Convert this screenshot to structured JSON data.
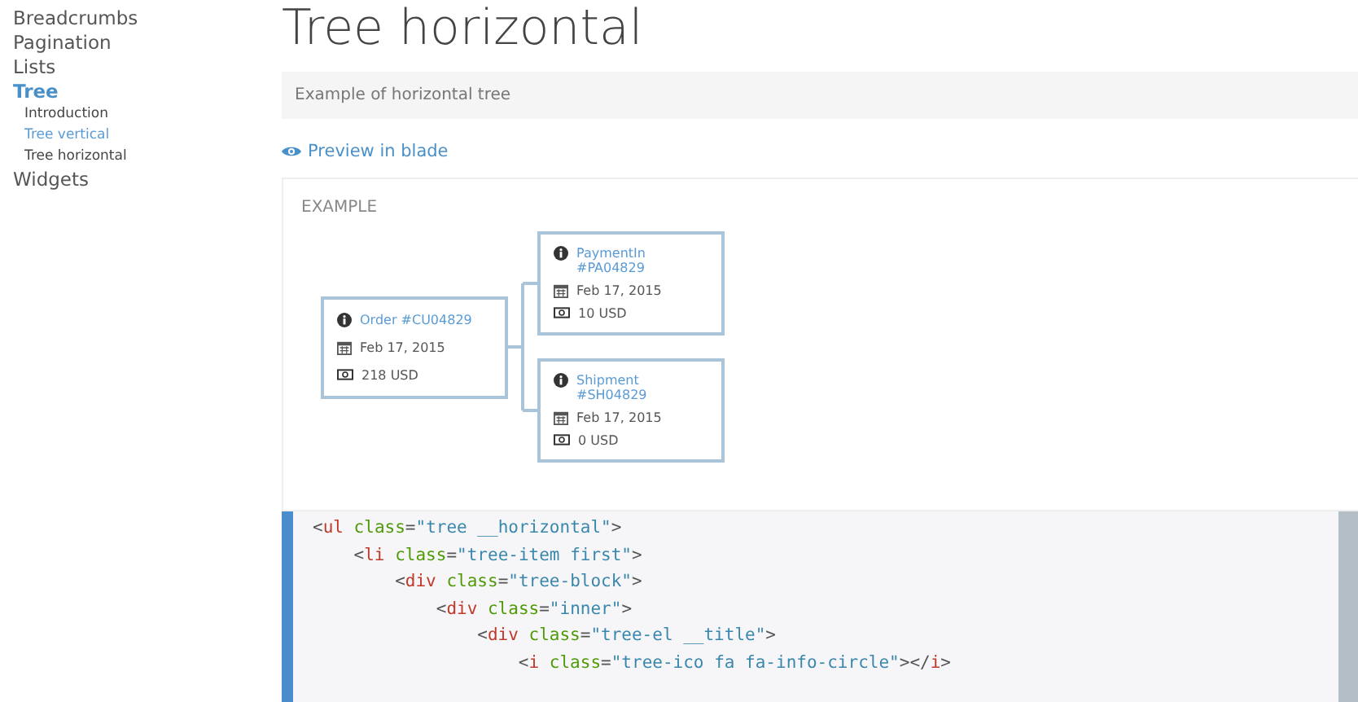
{
  "sidebar": {
    "items": [
      {
        "label": "Breadcrumbs",
        "selected": false
      },
      {
        "label": "Pagination",
        "selected": false
      },
      {
        "label": "Lists",
        "selected": false
      },
      {
        "label": "Tree",
        "selected": true,
        "children": [
          {
            "label": "Introduction",
            "selected": false
          },
          {
            "label": "Tree vertical",
            "selected": true
          },
          {
            "label": "Tree horizontal",
            "selected": false
          }
        ]
      },
      {
        "label": "Widgets",
        "selected": false
      }
    ]
  },
  "page": {
    "title": "Tree horizontal",
    "description": "Example of horizontal tree",
    "preview_link": "Preview in blade"
  },
  "example": {
    "heading": "EXAMPLE",
    "tree": {
      "title": "Order #CU04829",
      "date": "Feb 17, 2015",
      "amount": "218 USD",
      "children": [
        {
          "title": "PaymentIn #PA04829",
          "date": "Feb 17, 2015",
          "amount": "10 USD"
        },
        {
          "title": "Shipment #SH04829",
          "date": "Feb 17, 2015",
          "amount": "0 USD"
        }
      ]
    }
  },
  "code": {
    "lines": [
      [
        {
          "kind": "punct",
          "text": "<"
        },
        {
          "kind": "tag",
          "text": "ul"
        },
        {
          "kind": "attr",
          "text": " class"
        },
        {
          "kind": "punct",
          "text": "="
        },
        {
          "kind": "string",
          "text": "\"tree __horizontal\""
        },
        {
          "kind": "punct",
          "text": ">"
        }
      ],
      [
        {
          "kind": "punct",
          "text": "    <"
        },
        {
          "kind": "tag",
          "text": "li"
        },
        {
          "kind": "attr",
          "text": " class"
        },
        {
          "kind": "punct",
          "text": "="
        },
        {
          "kind": "string",
          "text": "\"tree-item first\""
        },
        {
          "kind": "punct",
          "text": ">"
        }
      ],
      [
        {
          "kind": "punct",
          "text": "        <"
        },
        {
          "kind": "tag",
          "text": "div"
        },
        {
          "kind": "attr",
          "text": " class"
        },
        {
          "kind": "punct",
          "text": "="
        },
        {
          "kind": "string",
          "text": "\"tree-block\""
        },
        {
          "kind": "punct",
          "text": ">"
        }
      ],
      [
        {
          "kind": "punct",
          "text": "            <"
        },
        {
          "kind": "tag",
          "text": "div"
        },
        {
          "kind": "attr",
          "text": " class"
        },
        {
          "kind": "punct",
          "text": "="
        },
        {
          "kind": "string",
          "text": "\"inner\""
        },
        {
          "kind": "punct",
          "text": ">"
        }
      ],
      [
        {
          "kind": "punct",
          "text": "                <"
        },
        {
          "kind": "tag",
          "text": "div"
        },
        {
          "kind": "attr",
          "text": " class"
        },
        {
          "kind": "punct",
          "text": "="
        },
        {
          "kind": "string",
          "text": "\"tree-el __title\""
        },
        {
          "kind": "punct",
          "text": ">"
        }
      ],
      [
        {
          "kind": "punct",
          "text": "                    <"
        },
        {
          "kind": "tag",
          "text": "i"
        },
        {
          "kind": "attr",
          "text": " class"
        },
        {
          "kind": "punct",
          "text": "="
        },
        {
          "kind": "string",
          "text": "\"tree-ico fa fa-info-circle\""
        },
        {
          "kind": "punct",
          "text": "></"
        },
        {
          "kind": "tag",
          "text": "i"
        },
        {
          "kind": "punct",
          "text": ">"
        }
      ]
    ]
  }
}
